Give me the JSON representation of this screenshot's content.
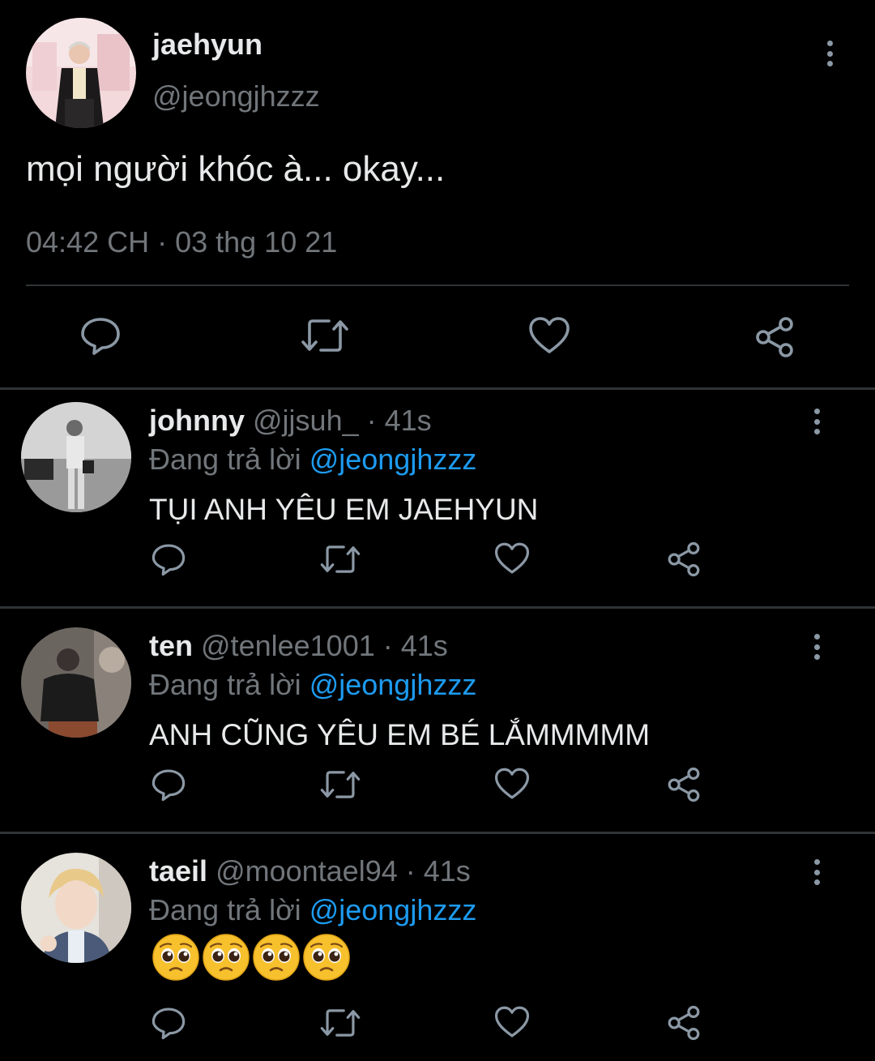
{
  "main_tweet": {
    "name": "jaehyun",
    "handle": "@jeongjhzzz",
    "text": "mọi người khóc à... okay...",
    "timestamp": "04:42 CH · 03 thg 10 21",
    "more_icon": "more-vertical-icon",
    "actions": [
      "reply-icon",
      "retweet-icon",
      "like-icon",
      "share-icon"
    ]
  },
  "replies": [
    {
      "name": "johnny",
      "meta": "@jjsuh_ · 41s",
      "replying_prefix": "Đang trả lời",
      "replying_to": "@jeongjhzzz",
      "text": "TỤI ANH YÊU EM JAEHYUN"
    },
    {
      "name": "ten",
      "meta": "@tenlee1001 · 41s",
      "replying_prefix": "Đang trả lời",
      "replying_to": "@jeongjhzzz",
      "text": "ANH CŨNG YÊU EM BÉ LẮMMMMM"
    },
    {
      "name": "taeil",
      "meta": "@moontael94 · 41s",
      "replying_prefix": "Đang trả lời",
      "replying_to": "@jeongjhzzz",
      "emojis": [
        "pleading-face-emoji",
        "pleading-face-emoji",
        "pleading-face-emoji",
        "pleading-face-emoji"
      ]
    }
  ],
  "colors": {
    "background": "#000000",
    "text": "#e7e9ea",
    "secondary": "#71767b",
    "accent": "#1d9bf0",
    "divider": "#2f3336"
  }
}
